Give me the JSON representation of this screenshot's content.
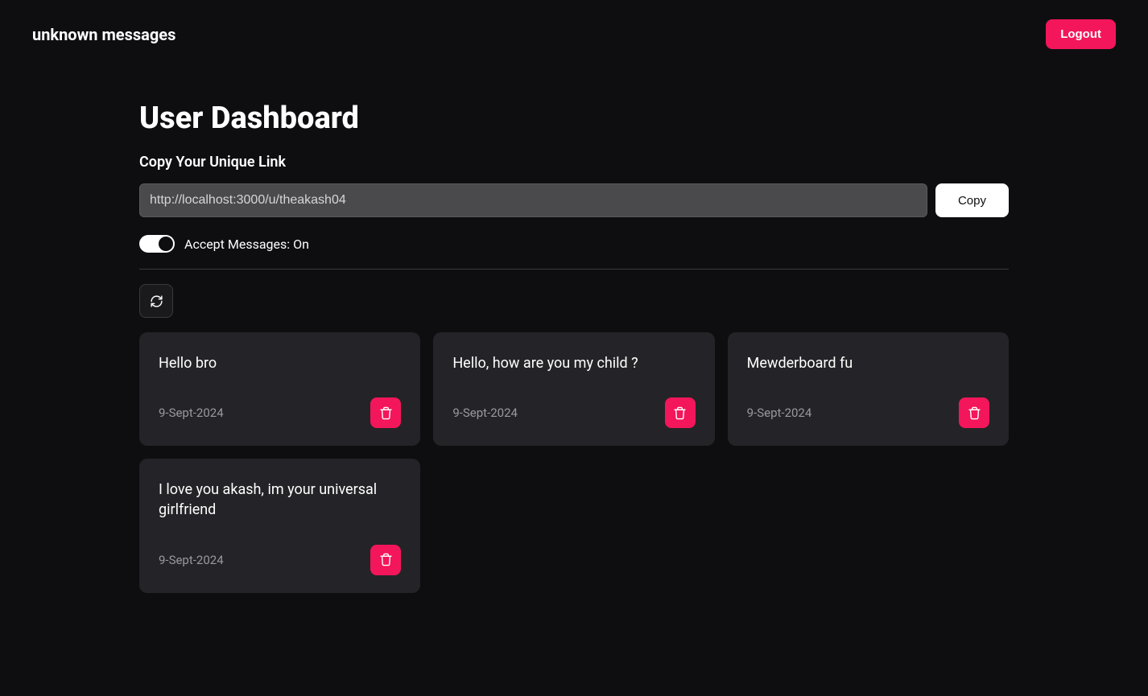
{
  "header": {
    "app_title": "unknown messages",
    "logout_label": "Logout"
  },
  "dashboard": {
    "title": "User Dashboard",
    "link_section_label": "Copy Your Unique Link",
    "link_value": "http://localhost:3000/u/theakash04",
    "copy_label": "Copy",
    "toggle_label": "Accept Messages: On"
  },
  "messages": [
    {
      "text": "Hello bro",
      "date": "9-Sept-2024"
    },
    {
      "text": "Hello, how are you my child ?",
      "date": "9-Sept-2024"
    },
    {
      "text": "Mewderboard fu",
      "date": "9-Sept-2024"
    },
    {
      "text": "I love you akash, im your universal girlfriend",
      "date": "9-Sept-2024"
    }
  ]
}
